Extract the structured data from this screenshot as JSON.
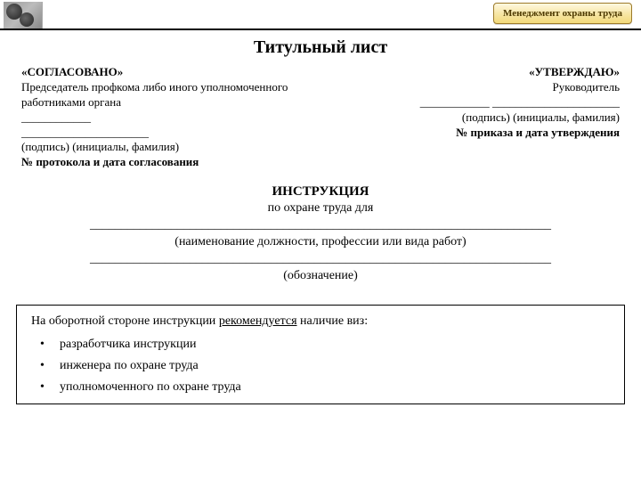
{
  "header": {
    "tab_label": "Менеджмент охраны труда"
  },
  "title": "Титульный лист",
  "left_block": {
    "heading": "«СОГЛАСОВАНО»",
    "subhead": "Председатель профкома либо иного уполномоченного работниками органа",
    "line1": "____________",
    "line2": "______________________",
    "sig_caption": "(подпись)   (инициалы, фамилия)",
    "protocol": "№ протокола и дата согласования"
  },
  "right_block": {
    "heading": "«УТВЕРЖДАЮ»",
    "subhead": "Руководитель",
    "line1": "____________ ______________________",
    "sig_caption": "(подпись)   (инициалы, фамилия)",
    "order": "№ приказа и дата утверждения"
  },
  "middle": {
    "instr_title": "ИНСТРУКЦИЯ",
    "instr_sub": "по охране труда для",
    "long_line": "__________________________________________________________________________",
    "caption1": "(наименование должности, профессии или вида работ)",
    "caption2": "(обозначение)"
  },
  "note": {
    "intro_pre": "На оборотной стороне инструкции ",
    "intro_emph": "рекомендуется",
    "intro_post": " наличие виз:",
    "items": [
      "разработчика инструкции",
      "инженера по охране труда",
      "уполномоченного по охране труда"
    ]
  }
}
